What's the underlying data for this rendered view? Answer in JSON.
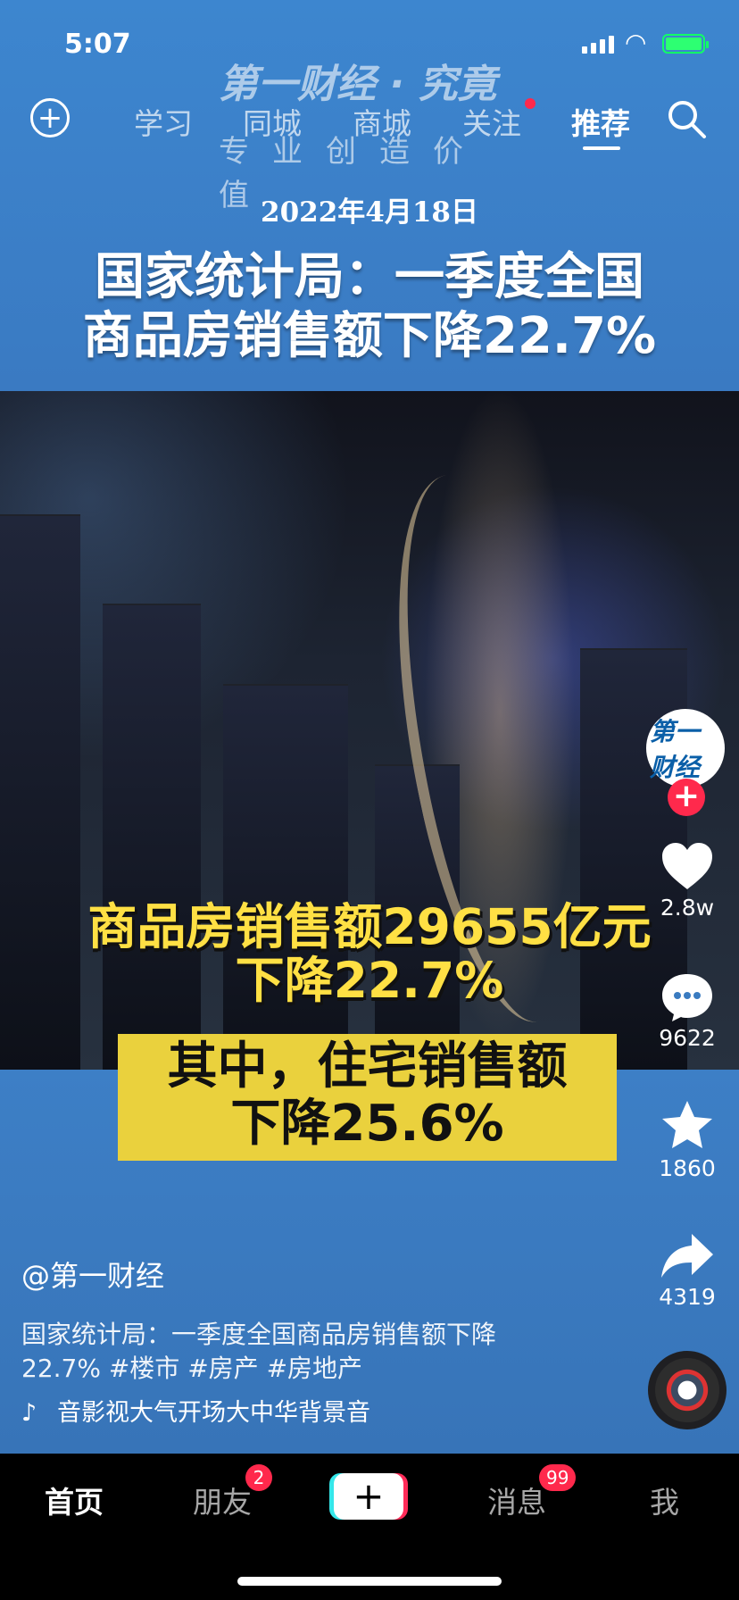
{
  "status": {
    "time": "5:07"
  },
  "watermark": {
    "logo": "第一财经 · 究竟",
    "slogan": "专业创造价值"
  },
  "nav": {
    "tabs": [
      "学习",
      "同城",
      "商城",
      "关注",
      "推荐"
    ],
    "active_tab": "推荐"
  },
  "video": {
    "date": "2022年4月18日",
    "headline_line1": "国家统计局：一季度全国",
    "headline_line2": "商品房销售额下降22.7%",
    "caption_line1": "商品房销售额29655亿元",
    "caption_line2": "下降22.7%",
    "caption_box_line1": "其中，住宅销售额",
    "caption_box_line2": "下降25.6%"
  },
  "creator": {
    "avatar_text": "第一财经",
    "follow_symbol": "+"
  },
  "actions": {
    "likes": "2.8w",
    "comments": "9622",
    "favorites": "1860",
    "shares": "4319"
  },
  "post": {
    "author": "@第一财经",
    "description": "国家统计局：一季度全国商品房销售额下降22.7% #楼市 #房产 #房地产",
    "music": "音影视大气开场大中华背景音"
  },
  "bottom_nav": {
    "home": "首页",
    "friends": "朋友",
    "friends_badge": "2",
    "create": "+",
    "messages": "消息",
    "messages_badge": "99",
    "me": "我"
  },
  "icons": {
    "add": "plus-circle-icon",
    "search": "search-icon",
    "like": "heart-icon",
    "comment": "comment-icon",
    "favorite": "star-icon",
    "share": "share-icon",
    "music": "music-note-icon"
  },
  "colors": {
    "accent_red": "#ff294c",
    "caption_yellow": "#ffe044",
    "caption_box": "#ead13d",
    "sky_blue": "#3d86cf"
  }
}
